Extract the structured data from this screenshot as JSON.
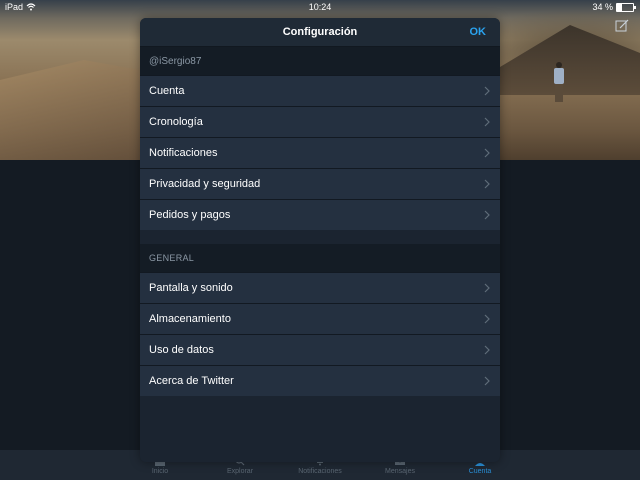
{
  "statusbar": {
    "device": "iPad",
    "time": "10:24",
    "battery_text": "34 %",
    "battery_level": 0.34
  },
  "modal": {
    "title": "Configuración",
    "ok_label": "OK",
    "account_section_header": "@iSergio87",
    "account_items": [
      {
        "label": "Cuenta"
      },
      {
        "label": "Cronología"
      },
      {
        "label": "Notificaciones"
      },
      {
        "label": "Privacidad y seguridad"
      },
      {
        "label": "Pedidos y pagos"
      }
    ],
    "general_section_header": "GENERAL",
    "general_items": [
      {
        "label": "Pantalla y sonido"
      },
      {
        "label": "Almacenamiento"
      },
      {
        "label": "Uso de datos"
      },
      {
        "label": "Acerca de Twitter"
      }
    ]
  },
  "tabbar": {
    "tabs": [
      {
        "label": "Inicio",
        "icon": "home-icon",
        "active": false
      },
      {
        "label": "Explorar",
        "icon": "search-icon",
        "active": false
      },
      {
        "label": "Notificaciones",
        "icon": "bell-icon",
        "active": false
      },
      {
        "label": "Mensajes",
        "icon": "envelope-icon",
        "active": false
      },
      {
        "label": "Cuenta",
        "icon": "person-icon",
        "active": true
      }
    ]
  },
  "colors": {
    "accent": "#2aa3ef",
    "modal_bg": "#1b2430",
    "row_bg": "#243040"
  }
}
